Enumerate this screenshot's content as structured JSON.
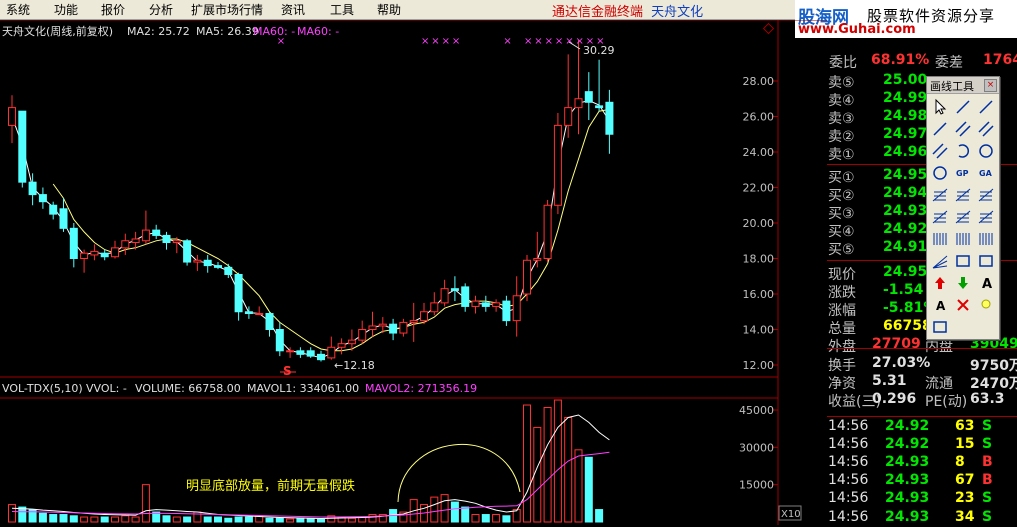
{
  "menu": {
    "items": [
      "系统",
      "功能",
      "报价",
      "分析",
      "扩展市场行情",
      "资讯",
      "工具",
      "帮助"
    ],
    "brand": "通达信金融终端",
    "stock_title": "天舟文化"
  },
  "watermark": {
    "line1": "股海网",
    "line2": "股票软件资源分享",
    "url": "www.Guhai.com"
  },
  "chart_header": {
    "title": "天舟文化(周线,前复权)",
    "ma2_label": "MA2: 25.72",
    "ma5_label": "MA5: 26.39",
    "ma60a_label": "MA60: -",
    "ma60b_label": "MA60: -"
  },
  "volume_header": {
    "label": "VOL-TDX(5,10)",
    "vvol": "VVOL: -",
    "volume": "VOLUME: 66758.00",
    "mavol1": "MAVOL1: 334061.00",
    "mavol2": "MAVOL2: 271356.19"
  },
  "annotations": {
    "high": "30.29",
    "low": "12.18",
    "s_marker": "S",
    "note": "明显底部放量，前期无量假跌",
    "x10": "X10"
  },
  "chart_data": {
    "type": "candlestick",
    "price_axis": {
      "ticks": [
        "28.00",
        "26.00",
        "24.00",
        "22.00",
        "20.00",
        "18.00",
        "16.00",
        "14.00",
        "12.00"
      ],
      "range": [
        11.0,
        31.7
      ]
    },
    "volume_axis": {
      "ticks": [
        "45000",
        "30000",
        "15000"
      ],
      "range": [
        0,
        52000
      ]
    },
    "colors": {
      "up": "#ff3232",
      "down": "#54ffff",
      "ma_fast": "#ffffff",
      "ma_slow": "#ffff80",
      "vol_ma1": "#ffffff",
      "vol_ma2": "#ff40ff"
    },
    "candles": [
      {
        "o": 25.5,
        "h": 27.2,
        "l": 24.5,
        "c": 26.5
      },
      {
        "o": 26.3,
        "h": 26.3,
        "l": 22.0,
        "c": 22.3
      },
      {
        "o": 22.3,
        "h": 22.8,
        "l": 21.0,
        "c": 21.6
      },
      {
        "o": 21.6,
        "h": 22.0,
        "l": 20.8,
        "c": 21.2
      },
      {
        "o": 21.0,
        "h": 21.2,
        "l": 20.2,
        "c": 20.5
      },
      {
        "o": 20.8,
        "h": 21.4,
        "l": 19.5,
        "c": 19.7
      },
      {
        "o": 19.7,
        "h": 20.0,
        "l": 17.5,
        "c": 18.0
      },
      {
        "o": 18.0,
        "h": 18.5,
        "l": 17.2,
        "c": 18.3
      },
      {
        "o": 18.2,
        "h": 18.8,
        "l": 17.9,
        "c": 18.4
      },
      {
        "o": 18.3,
        "h": 18.5,
        "l": 17.9,
        "c": 18.1
      },
      {
        "o": 18.1,
        "h": 19.0,
        "l": 18.0,
        "c": 18.6
      },
      {
        "o": 18.6,
        "h": 19.4,
        "l": 18.2,
        "c": 19.0
      },
      {
        "o": 18.9,
        "h": 19.5,
        "l": 18.5,
        "c": 19.1
      },
      {
        "o": 19.0,
        "h": 20.7,
        "l": 18.8,
        "c": 19.6
      },
      {
        "o": 19.6,
        "h": 19.9,
        "l": 19.1,
        "c": 19.3
      },
      {
        "o": 19.3,
        "h": 19.5,
        "l": 18.5,
        "c": 18.9
      },
      {
        "o": 18.9,
        "h": 19.2,
        "l": 18.3,
        "c": 19.0
      },
      {
        "o": 19.0,
        "h": 19.1,
        "l": 17.6,
        "c": 17.8
      },
      {
        "o": 17.8,
        "h": 18.2,
        "l": 17.3,
        "c": 17.9
      },
      {
        "o": 17.9,
        "h": 18.2,
        "l": 17.2,
        "c": 17.6
      },
      {
        "o": 17.6,
        "h": 17.8,
        "l": 17.4,
        "c": 17.5
      },
      {
        "o": 17.5,
        "h": 17.7,
        "l": 16.9,
        "c": 17.1
      },
      {
        "o": 17.1,
        "h": 17.2,
        "l": 14.5,
        "c": 15.0
      },
      {
        "o": 15.0,
        "h": 15.3,
        "l": 14.6,
        "c": 14.9
      },
      {
        "o": 14.9,
        "h": 15.3,
        "l": 14.8,
        "c": 14.9
      },
      {
        "o": 14.9,
        "h": 15.0,
        "l": 13.6,
        "c": 14.0
      },
      {
        "o": 14.0,
        "h": 14.4,
        "l": 12.5,
        "c": 12.8
      },
      {
        "o": 12.8,
        "h": 13.0,
        "l": 12.4,
        "c": 12.8
      },
      {
        "o": 12.8,
        "h": 13.0,
        "l": 12.4,
        "c": 12.6
      },
      {
        "o": 12.8,
        "h": 13.0,
        "l": 12.4,
        "c": 12.5
      },
      {
        "o": 12.6,
        "h": 12.8,
        "l": 12.2,
        "c": 12.3
      },
      {
        "o": 12.4,
        "h": 13.6,
        "l": 12.3,
        "c": 13.0
      },
      {
        "o": 13.0,
        "h": 13.5,
        "l": 12.6,
        "c": 13.2
      },
      {
        "o": 13.2,
        "h": 14.0,
        "l": 12.8,
        "c": 13.4
      },
      {
        "o": 13.4,
        "h": 14.5,
        "l": 13.2,
        "c": 14.0
      },
      {
        "o": 14.0,
        "h": 15.0,
        "l": 13.6,
        "c": 14.2
      },
      {
        "o": 14.2,
        "h": 14.7,
        "l": 13.8,
        "c": 14.3
      },
      {
        "o": 14.3,
        "h": 14.6,
        "l": 13.4,
        "c": 13.8
      },
      {
        "o": 13.8,
        "h": 14.6,
        "l": 13.6,
        "c": 14.4
      },
      {
        "o": 14.4,
        "h": 15.5,
        "l": 13.3,
        "c": 14.5
      },
      {
        "o": 14.5,
        "h": 15.5,
        "l": 14.3,
        "c": 15.0
      },
      {
        "o": 15.0,
        "h": 16.1,
        "l": 14.8,
        "c": 15.5
      },
      {
        "o": 15.5,
        "h": 16.8,
        "l": 15.3,
        "c": 16.3
      },
      {
        "o": 16.3,
        "h": 17.0,
        "l": 15.6,
        "c": 16.2
      },
      {
        "o": 16.4,
        "h": 16.6,
        "l": 15.0,
        "c": 15.3
      },
      {
        "o": 15.3,
        "h": 15.9,
        "l": 14.9,
        "c": 15.6
      },
      {
        "o": 15.5,
        "h": 15.9,
        "l": 15.0,
        "c": 15.3
      },
      {
        "o": 15.3,
        "h": 15.7,
        "l": 15.0,
        "c": 15.5
      },
      {
        "o": 15.6,
        "h": 15.9,
        "l": 14.2,
        "c": 14.5
      },
      {
        "o": 14.5,
        "h": 17.0,
        "l": 13.6,
        "c": 15.9
      },
      {
        "o": 16.0,
        "h": 18.2,
        "l": 15.6,
        "c": 17.9
      },
      {
        "o": 17.9,
        "h": 19.5,
        "l": 17.5,
        "c": 18.0
      },
      {
        "o": 18.0,
        "h": 21.3,
        "l": 17.8,
        "c": 21.0
      },
      {
        "o": 21.0,
        "h": 26.2,
        "l": 20.5,
        "c": 25.5
      },
      {
        "o": 25.5,
        "h": 29.5,
        "l": 24.8,
        "c": 26.5
      },
      {
        "o": 26.5,
        "h": 30.3,
        "l": 25.0,
        "c": 27.0
      },
      {
        "o": 27.4,
        "h": 28.5,
        "l": 25.8,
        "c": 26.8
      },
      {
        "o": 26.6,
        "h": 29.2,
        "l": 26.3,
        "c": 26.5
      },
      {
        "o": 26.8,
        "h": 27.5,
        "l": 23.9,
        "c": 25.0
      }
    ],
    "ma_fast": [
      26.0,
      24.4,
      22.0,
      21.4,
      20.9,
      20.1,
      18.9,
      18.2,
      18.35,
      18.25,
      18.35,
      18.8,
      19.05,
      19.35,
      19.45,
      19.1,
      18.95,
      18.4,
      17.85,
      17.75,
      17.55,
      17.3,
      16.1,
      14.95,
      14.9,
      14.45,
      13.4,
      12.8,
      12.7,
      12.55,
      12.4,
      12.65,
      13.1,
      13.3,
      13.7,
      14.1,
      14.25,
      14.05,
      14.1,
      14.45,
      14.75,
      15.25,
      15.9,
      16.25,
      15.75,
      15.45,
      15.45,
      15.4,
      15.0,
      15.2,
      16.9,
      17.95,
      19.5,
      23.25,
      26.0,
      26.75,
      26.9,
      26.65,
      25.75
    ],
    "ma_slow": [
      null,
      null,
      null,
      null,
      22.2,
      21.4,
      20.2,
      19.5,
      18.9,
      18.5,
      18.3,
      18.5,
      18.6,
      18.8,
      19.0,
      19.1,
      19.1,
      18.9,
      18.6,
      18.3,
      18.0,
      17.6,
      17.1,
      16.5,
      15.9,
      15.0,
      14.4,
      14.0,
      13.6,
      13.2,
      12.9,
      12.8,
      12.8,
      12.9,
      13.2,
      13.6,
      13.9,
      14.0,
      14.1,
      14.3,
      14.4,
      14.7,
      15.2,
      15.4,
      15.5,
      15.6,
      15.6,
      15.5,
      15.3,
      15.4,
      16.0,
      16.7,
      17.7,
      19.6,
      21.8,
      23.6,
      25.4,
      26.3,
      26.4
    ],
    "volumes": [
      7000,
      6000,
      5000,
      3500,
      3000,
      3000,
      2500,
      2000,
      2000,
      2000,
      2000,
      2500,
      2000,
      15000,
      4000,
      2500,
      2000,
      2000,
      4000,
      2000,
      2000,
      1500,
      2000,
      2000,
      2500,
      1500,
      1500,
      1200,
      1500,
      1200,
      1000,
      2500,
      2000,
      1500,
      2000,
      3000,
      3000,
      5000,
      4000,
      9000,
      7000,
      10000,
      11000,
      8000,
      6000,
      3000,
      3000,
      3000,
      2500,
      5000,
      47000,
      38000,
      46000,
      49000,
      42000,
      29000,
      26000,
      5000
    ],
    "vol_ma1": [
      5500,
      5400,
      5200,
      4800,
      4500,
      4200,
      3800,
      3500,
      3200,
      3000,
      2900,
      2800,
      2700,
      4500,
      5000,
      4800,
      4500,
      4200,
      4000,
      3500,
      3000,
      2800,
      2600,
      2400,
      2200,
      2000,
      1800,
      1700,
      1600,
      1500,
      1400,
      1500,
      1600,
      1700,
      1800,
      2000,
      2300,
      2800,
      3200,
      4500,
      5500,
      7000,
      8500,
      9000,
      8400,
      7500,
      6000,
      4800,
      4000,
      4500,
      12000,
      22000,
      31000,
      38000,
      42000,
      43000,
      40000,
      36000,
      33000
    ],
    "vol_ma2": [
      4200,
      4150,
      4100,
      4000,
      3900,
      3800,
      3700,
      3600,
      3500,
      3400,
      3300,
      3250,
      3200,
      3400,
      3500,
      3450,
      3400,
      3300,
      3200,
      3100,
      3000,
      2900,
      2800,
      2700,
      2600,
      2500,
      2400,
      2300,
      2200,
      2100,
      2000,
      2000,
      2050,
      2100,
      2150,
      2250,
      2400,
      2600,
      2800,
      3200,
      3600,
      4200,
      4800,
      5300,
      5600,
      5900,
      6100,
      6300,
      6400,
      6500,
      9000,
      13000,
      17000,
      21000,
      24500,
      26500,
      27000,
      27500,
      28000
    ]
  },
  "quote": {
    "top_label1": "委比",
    "top_val1": "68.91%",
    "top_label2": "委差",
    "top_val2": "1764",
    "sell": [
      {
        "label": "卖⑤",
        "price": "25.00"
      },
      {
        "label": "卖④",
        "price": "24.99"
      },
      {
        "label": "卖③",
        "price": "24.98"
      },
      {
        "label": "卖②",
        "price": "24.97"
      },
      {
        "label": "卖①",
        "price": "24.96"
      }
    ],
    "buy": [
      {
        "label": "买①",
        "price": "24.95"
      },
      {
        "label": "买②",
        "price": "24.94"
      },
      {
        "label": "买③",
        "price": "24.93"
      },
      {
        "label": "买④",
        "price": "24.92"
      },
      {
        "label": "买⑤",
        "price": "24.91"
      }
    ],
    "stats": [
      {
        "label": "现价",
        "value": "24.95",
        "cls": "green"
      },
      {
        "label": "涨跌",
        "value": "-1.54",
        "cls": "green"
      },
      {
        "label": "涨幅",
        "value": "-5.81%",
        "cls": "green"
      },
      {
        "label": "总量",
        "value": "66758",
        "cls": "yellow"
      },
      {
        "label": "外盘",
        "value": "27709",
        "cls": "red",
        "label2": "内盘",
        "value2": "39049",
        "cls2": "green"
      },
      {
        "label": "换手",
        "value": "27.03%",
        "cls": "white",
        "label2": "",
        "value2": "9750万",
        "cls2": "white"
      },
      {
        "label": "净资",
        "value": "5.31",
        "cls": "white",
        "label2": "流通",
        "value2": "2470万",
        "cls2": "white"
      },
      {
        "label": "收益(三)",
        "value": "0.296",
        "cls": "white",
        "label2": "PE(动)",
        "value2": "63.3",
        "cls2": "white"
      }
    ],
    "ticks": [
      {
        "time": "14:56",
        "price": "24.92",
        "vol": "63",
        "bs": "S"
      },
      {
        "time": "14:56",
        "price": "24.92",
        "vol": "15",
        "bs": "S"
      },
      {
        "time": "14:56",
        "price": "24.93",
        "vol": "8",
        "bs": "B"
      },
      {
        "time": "14:56",
        "price": "24.93",
        "vol": "67",
        "bs": "B"
      },
      {
        "time": "14:56",
        "price": "24.93",
        "vol": "23",
        "bs": "S"
      },
      {
        "time": "14:56",
        "price": "24.93",
        "vol": "34",
        "bs": "S"
      }
    ]
  },
  "draw_tool": {
    "title": "画线工具",
    "close": "×"
  }
}
